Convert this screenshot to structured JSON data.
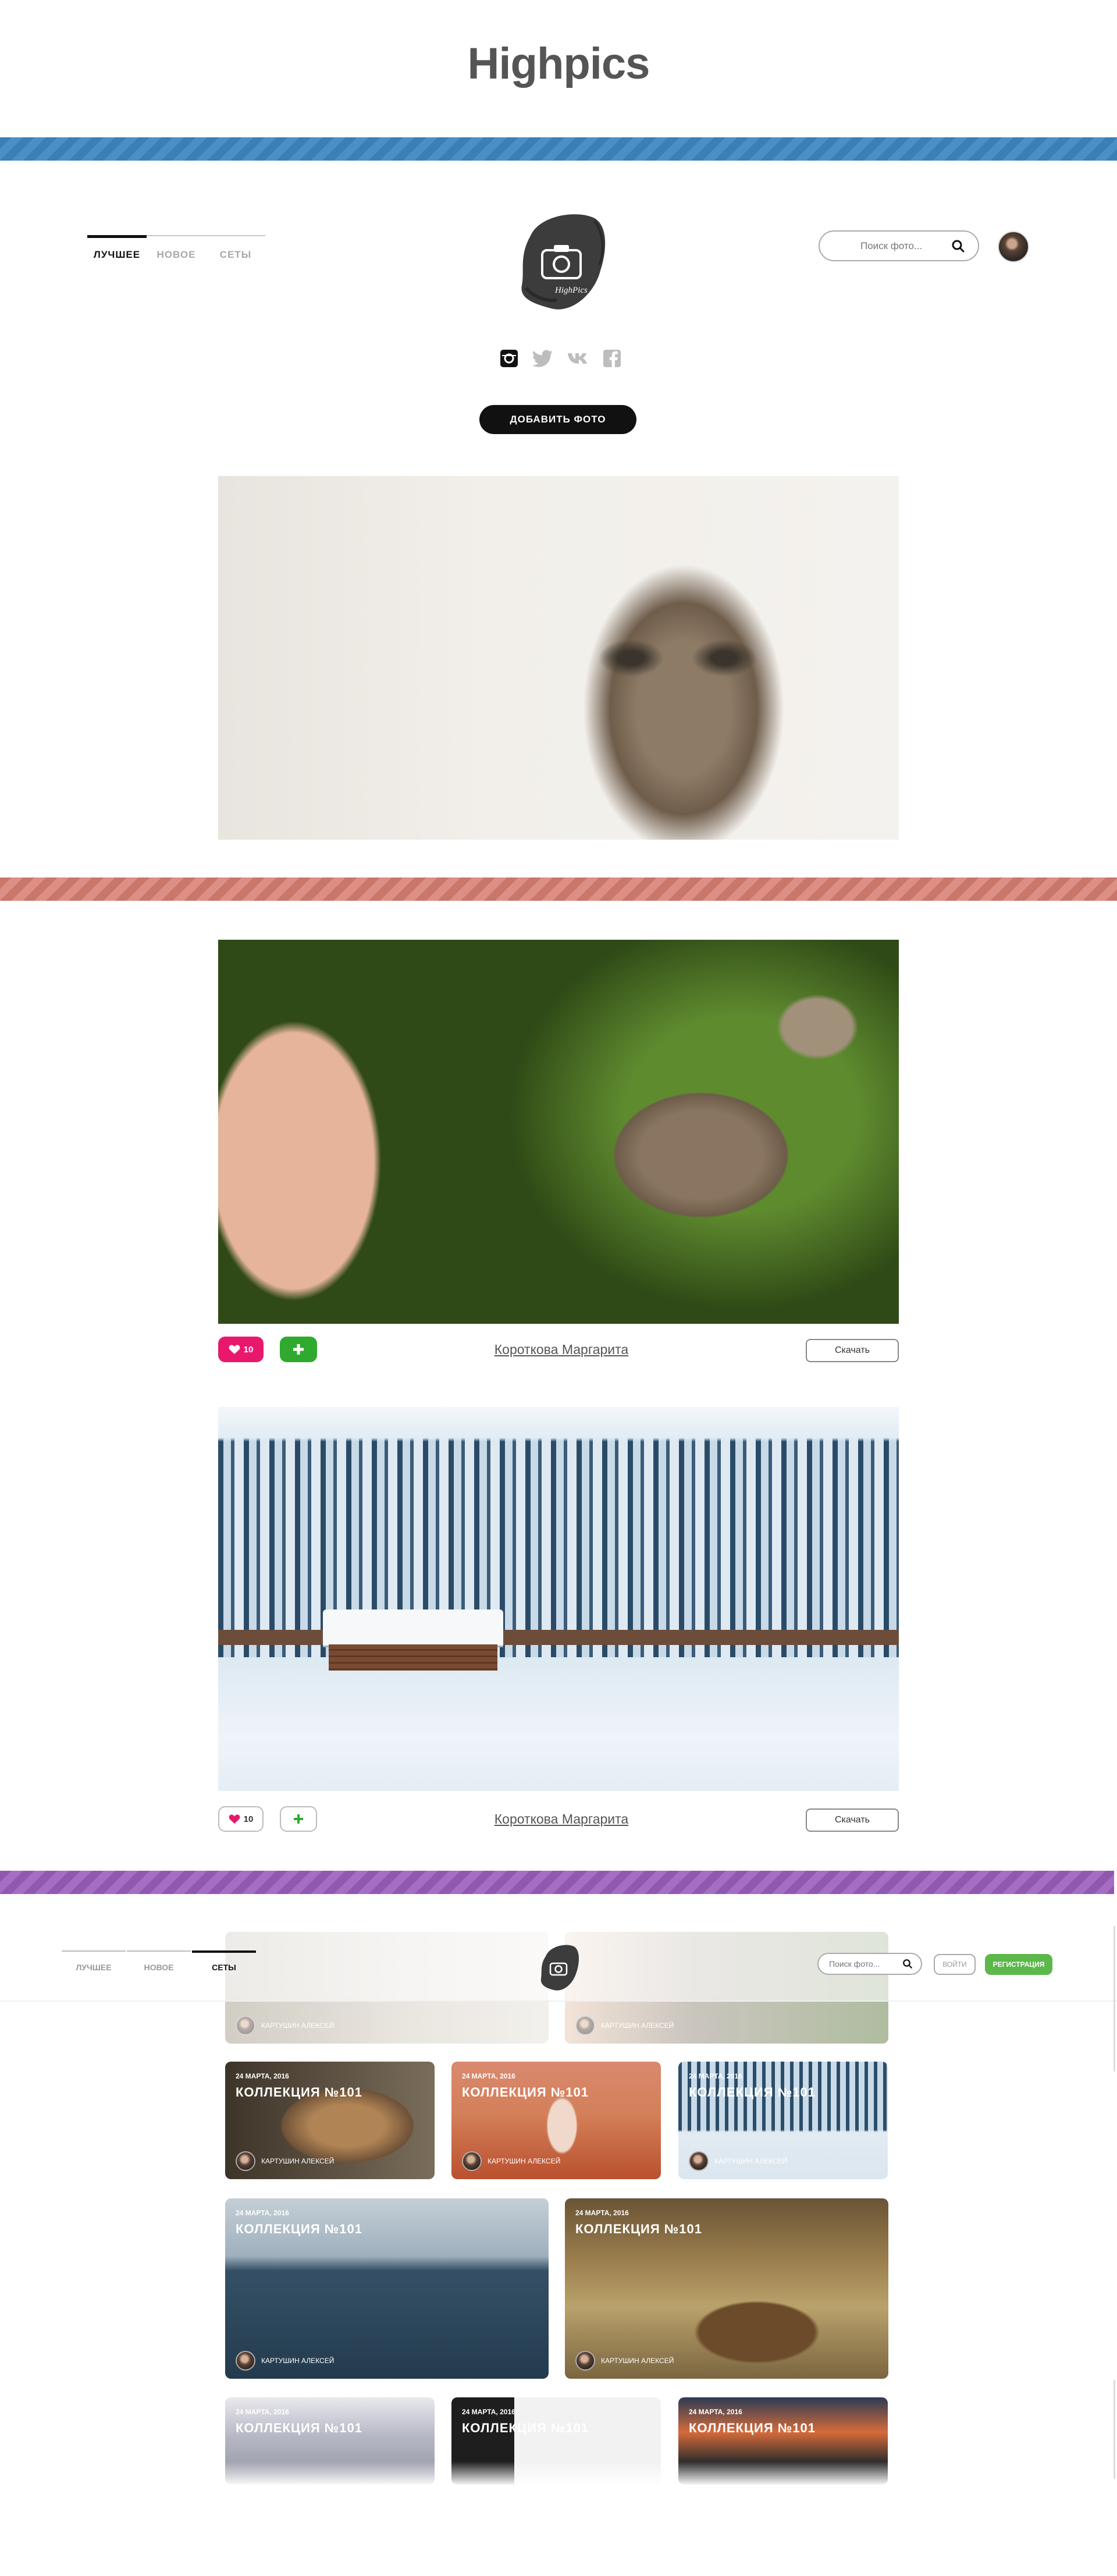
{
  "site": {
    "title": "Highpics",
    "logo_text": "HighPics"
  },
  "header": {
    "tabs": [
      {
        "label": "ЛУЧШЕЕ",
        "active": true
      },
      {
        "label": "НОВОЕ",
        "active": false
      },
      {
        "label": "СЕТЫ",
        "active": false
      }
    ],
    "search_placeholder": "Поиск фото...",
    "socials": [
      "instagram-icon",
      "twitter-icon",
      "vk-icon",
      "facebook-icon"
    ],
    "add_photo_label": "ДОБАВИТЬ ФОТО"
  },
  "photos": [
    {
      "subject": "cat"
    },
    {
      "subject": "bird",
      "likes": "10",
      "author": "Короткова Маргарита",
      "download_label": "Скачать",
      "liked": true
    },
    {
      "subject": "snowy forest cabin",
      "likes": "10",
      "author": "Короткова Маргарита",
      "download_label": "Скачать",
      "liked": false
    }
  ],
  "sets_header": {
    "tabs": [
      {
        "label": "ЛУЧШЕЕ",
        "active": false
      },
      {
        "label": "НОВОЕ",
        "active": false
      },
      {
        "label": "СЕТЫ",
        "active": true
      }
    ],
    "search_placeholder": "Поиск фото...",
    "login_label": "ВОЙТИ",
    "register_label": "РЕГИСТРАЦИЯ"
  },
  "sets": {
    "top_cards": [
      {
        "author": "КАРТУШИН АЛЕКСЕЙ"
      },
      {
        "author": "КАРТУШИН АЛЕКСЕЙ"
      }
    ],
    "cards": [
      {
        "date": "24 МАРТА, 2016",
        "title": "КОЛЛЕКЦИЯ №101",
        "author": "КАРТУШИН АЛЕКСЕЙ"
      },
      {
        "date": "24 МАРТА, 2016",
        "title": "КОЛЛЕКЦИЯ №101",
        "author": "КАРТУШИН АЛЕКСЕЙ"
      },
      {
        "date": "24 МАРТА, 2016",
        "title": "КОЛЛЕКЦИЯ №101",
        "author": "КАРТУШИН АЛЕКСЕЙ"
      },
      {
        "date": "24 МАРТА, 2016",
        "title": "КОЛЛЕКЦИЯ №101",
        "author": "КАРТУШИН АЛЕКСЕЙ"
      },
      {
        "date": "24 МАРТА, 2016",
        "title": "КОЛЛЕКЦИЯ №101",
        "author": "КАРТУШИН АЛЕКСЕЙ"
      },
      {
        "date": "24 МАРТА, 2016",
        "title": "КОЛЛЕКЦИЯ №101"
      },
      {
        "date": "24 МАРТА, 2016",
        "title": "КОЛЛЕКЦИЯ №101"
      },
      {
        "date": "24 МАРТА, 2016",
        "title": "КОЛЛЕКЦИЯ №101"
      }
    ]
  },
  "colors": {
    "stripe_blue": "#3a7fb7",
    "stripe_red": "#c9766b",
    "stripe_purple": "#9258b0",
    "like_pink": "#e8196c",
    "add_green": "#2faa2f",
    "register_green": "#5cb84a"
  }
}
